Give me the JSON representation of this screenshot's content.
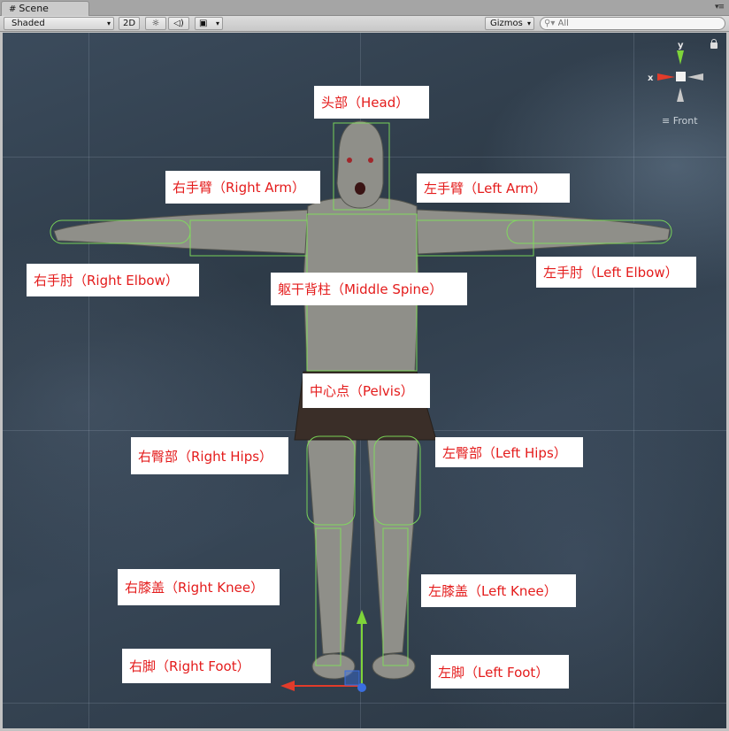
{
  "tab": {
    "title": "Scene",
    "icon": "scene-grid-icon"
  },
  "toolbar": {
    "shading_mode": "Shaded",
    "mode_2d": "2D",
    "lighting_icon": "sun-icon",
    "audio_icon": "speaker-icon",
    "effects_icon": "image-icon",
    "gizmos_label": "Gizmos",
    "search_placeholder": "All"
  },
  "gizmo": {
    "y_label": "y",
    "x_label": "x",
    "view_name": "Front"
  },
  "labels": {
    "head": "头部（Head）",
    "right_arm": "右手臂（Right Arm）",
    "left_arm": "左手臂（Left Arm）",
    "right_elbow": "右手肘（Right Elbow）",
    "left_elbow": "左手肘（Left Elbow）",
    "middle_spine": "躯干背柱（Middle Spine）",
    "pelvis": "中心点（Pelvis）",
    "right_hips": "右臀部（Right Hips）",
    "left_hips": "左臀部（Left Hips）",
    "right_knee": "右膝盖（Right Knee）",
    "left_knee": "左膝盖（Left Knee）",
    "right_foot": "右脚（Right Foot）",
    "left_foot": "左脚（Left Foot）"
  },
  "colors": {
    "label_text": "#e41c1c",
    "collider_outline": "#7fe25a",
    "axis_x": "#e23b2a",
    "axis_y": "#7ed43a",
    "axis_z": "#3a6ee0"
  }
}
